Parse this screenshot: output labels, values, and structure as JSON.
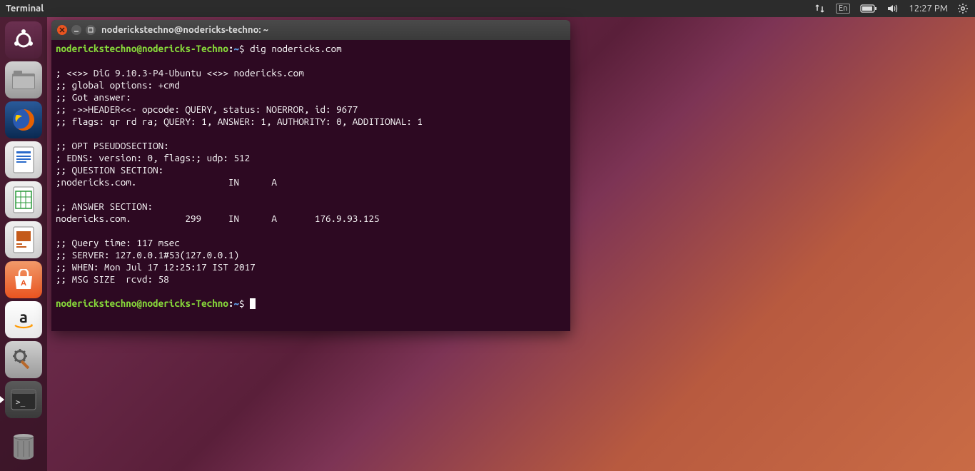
{
  "top_panel": {
    "app_name": "Terminal",
    "clock": "12:27 PM",
    "lang": "En"
  },
  "launcher": {
    "items": [
      {
        "name": "dash",
        "color": "#dd4814"
      },
      {
        "name": "files",
        "color": "#b9b9b9"
      },
      {
        "name": "firefox",
        "color": "#0a2a52"
      },
      {
        "name": "writer",
        "color": "#1a7ac6"
      },
      {
        "name": "calc",
        "color": "#2a9a3a"
      },
      {
        "name": "impress",
        "color": "#c45a1a"
      },
      {
        "name": "software",
        "color": "#e95420"
      },
      {
        "name": "amazon",
        "color": "#f2f2f2"
      },
      {
        "name": "settings",
        "color": "#9a9a9a"
      },
      {
        "name": "terminal",
        "color": "#3a3a3a",
        "active": true
      }
    ],
    "trash": {
      "name": "trash"
    }
  },
  "terminal": {
    "title": "noderickstechno@nodericks-techno: ~",
    "prompt": {
      "user_host": "noderickstechno@nodericks-Techno",
      "path": "~",
      "symbol": "$"
    },
    "command": "dig nodericks.com",
    "output_lines": [
      "",
      "; <<>> DiG 9.10.3-P4-Ubuntu <<>> nodericks.com",
      ";; global options: +cmd",
      ";; Got answer:",
      ";; ->>HEADER<<- opcode: QUERY, status: NOERROR, id: 9677",
      ";; flags: qr rd ra; QUERY: 1, ANSWER: 1, AUTHORITY: 0, ADDITIONAL: 1",
      "",
      ";; OPT PSEUDOSECTION:",
      "; EDNS: version: 0, flags:; udp: 512",
      ";; QUESTION SECTION:",
      ";nodericks.com.                 IN      A",
      "",
      ";; ANSWER SECTION:",
      "nodericks.com.          299     IN      A       176.9.93.125",
      "",
      ";; Query time: 117 msec",
      ";; SERVER: 127.0.0.1#53(127.0.0.1)",
      ";; WHEN: Mon Jul 17 12:25:17 IST 2017",
      ";; MSG SIZE  rcvd: 58",
      ""
    ]
  }
}
